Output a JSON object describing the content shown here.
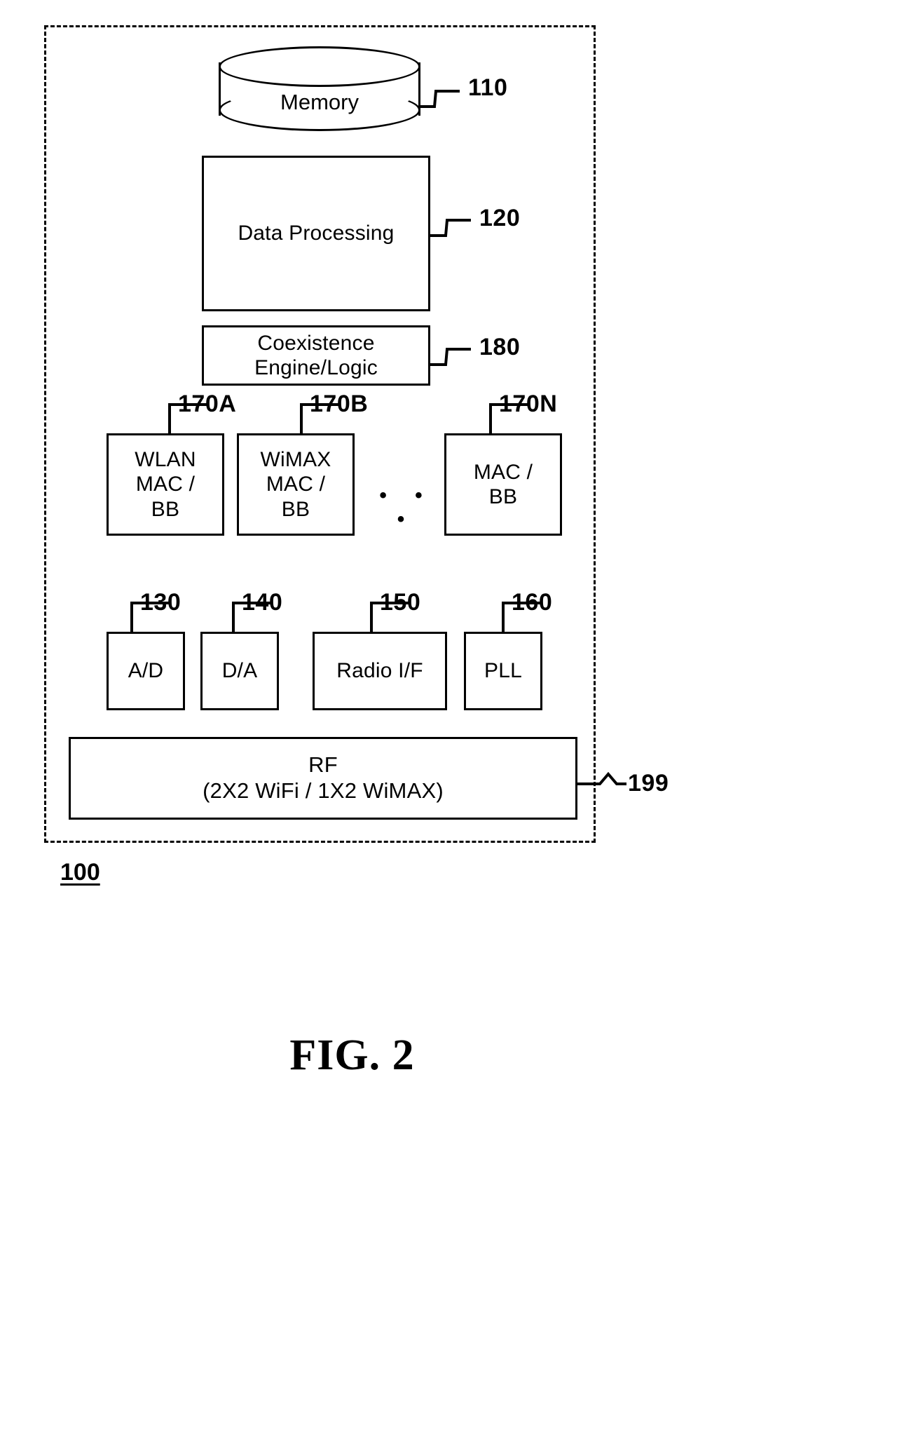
{
  "figure": {
    "caption": "FIG. 2",
    "system_numeral": "100"
  },
  "blocks": {
    "memory": {
      "label": "Memory",
      "ref": "110"
    },
    "data_processing": {
      "label": "Data Processing",
      "ref": "120"
    },
    "coexistence": {
      "line1": "Coexistence",
      "line2": "Engine/Logic",
      "ref": "180"
    },
    "mac_bb": [
      {
        "line1": "WLAN",
        "line2": "MAC /",
        "line3": "BB",
        "ref": "170A"
      },
      {
        "line1": "WiMAX",
        "line2": "MAC /",
        "line3": "BB",
        "ref": "170B"
      },
      {
        "line1": "",
        "line2": "MAC /",
        "line3": "BB",
        "ref": "170N"
      }
    ],
    "ellipsis": "• • •",
    "converters": [
      {
        "label": "A/D",
        "ref": "130"
      },
      {
        "label": "D/A",
        "ref": "140"
      },
      {
        "label": "Radio I/F",
        "ref": "150"
      },
      {
        "label": "PLL",
        "ref": "160"
      }
    ],
    "rf": {
      "line1": "RF",
      "line2": "(2X2 WiFi / 1X2 WiMAX)",
      "ref": "199"
    }
  },
  "colors": {
    "stroke": "#000000",
    "background": "#ffffff"
  }
}
